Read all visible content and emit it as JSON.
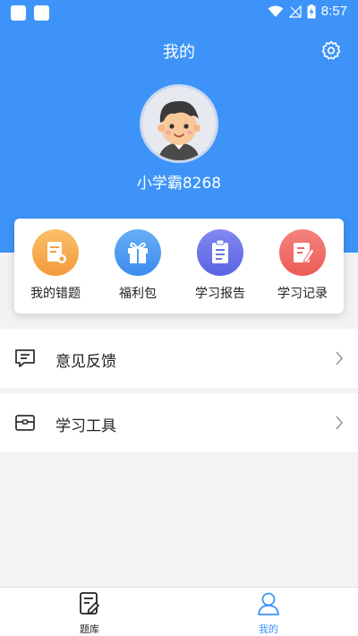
{
  "status_bar": {
    "time": "8:57"
  },
  "header": {
    "title": "我的",
    "username": "小学霸8268"
  },
  "quick_actions": [
    {
      "label": "我的错题",
      "icon": "wrong-questions-icon",
      "color": "#f7a84a"
    },
    {
      "label": "福利包",
      "icon": "gift-icon",
      "color": "#4d9cf2"
    },
    {
      "label": "学习报告",
      "icon": "clipboard-icon",
      "color": "#6b74ea"
    },
    {
      "label": "学习记录",
      "icon": "edit-record-icon",
      "color": "#f06a64"
    }
  ],
  "menu": [
    {
      "label": "意见反馈",
      "icon": "feedback-icon"
    },
    {
      "label": "学习工具",
      "icon": "toolbox-icon"
    }
  ],
  "tabbar": {
    "tabs": [
      {
        "label": "题库",
        "icon": "question-bank-icon",
        "active": false
      },
      {
        "label": "我的",
        "icon": "profile-icon",
        "active": true
      }
    ],
    "active_color": "#3d93f8",
    "inactive_color": "#222222"
  },
  "colors": {
    "header_bg": "#3d93f8",
    "page_bg": "#f3f3f5"
  }
}
